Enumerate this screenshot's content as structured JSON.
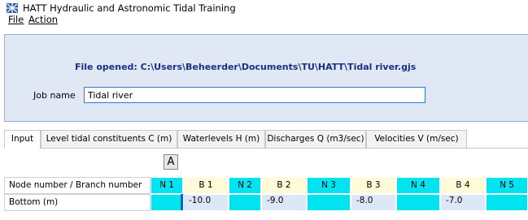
{
  "app": {
    "title": "HATT   Hydraulic and Astronomic Tidal Training"
  },
  "menu": {
    "file": "File",
    "action": "Action"
  },
  "header": {
    "file_opened": "File opened: C:\\Users\\Beheerder\\Documents\\TU\\HATT\\Tidal river.gjs",
    "job_name_label": "Job name",
    "job_name_value": "Tidal river"
  },
  "tabs": [
    {
      "label": "Input",
      "active": true
    },
    {
      "label": "Level tidal constituents C  (m)",
      "active": false
    },
    {
      "label": "Waterlevels H (m)",
      "active": false
    },
    {
      "label": "Discharges Q (m3/sec)",
      "active": false
    },
    {
      "label": "Velocities V (m/sec)",
      "active": false
    }
  ],
  "a_button": "A",
  "table": {
    "header_label": "Node number / Branch number",
    "columns": [
      "N 1",
      "B 1",
      "N 2",
      "B 2",
      "N 3",
      "B 3",
      "N 4",
      "B 4",
      "N 5"
    ],
    "rows": [
      {
        "label": "Bottom (m)",
        "values": [
          "",
          "-10.0",
          "",
          "-9.0",
          "",
          "-8.0",
          "",
          "-7.0",
          ""
        ]
      }
    ]
  },
  "colors": {
    "node": "#00e4f2",
    "branch": "#fdfbd8",
    "value_cell": "#dde8f7",
    "header_panel": "#dfe8f4",
    "file_opened_text": "#1a2f86"
  }
}
